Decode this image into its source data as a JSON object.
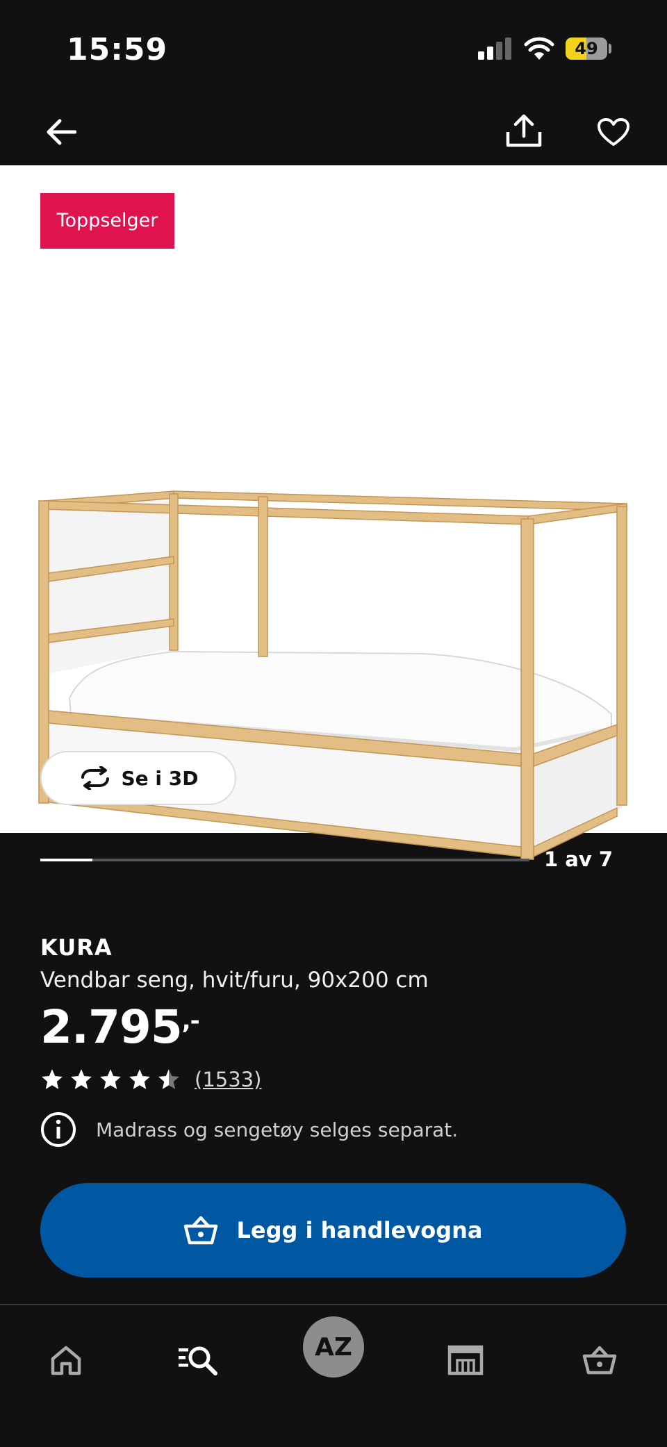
{
  "status_bar": {
    "time": "15:59",
    "battery_level": "49"
  },
  "gallery": {
    "badge": "Toppselger",
    "view_3d_label": "Se i 3D",
    "counter": "1 av 7",
    "progress_fraction": 0.107
  },
  "product": {
    "name": "KURA",
    "description": "Vendbar seng, hvit/furu, 90x200 cm",
    "price": "2.795",
    "price_suffix": ",-",
    "rating": 4.5,
    "reviews": "(1533)",
    "notice": "Madrass og sengetøy selges separat."
  },
  "cta": {
    "label": "Legg i handlevogna"
  },
  "tabbar": {
    "az_label": "AZ"
  },
  "colors": {
    "badge": "#e0134f",
    "cta": "#0058a3",
    "background": "#111111"
  }
}
